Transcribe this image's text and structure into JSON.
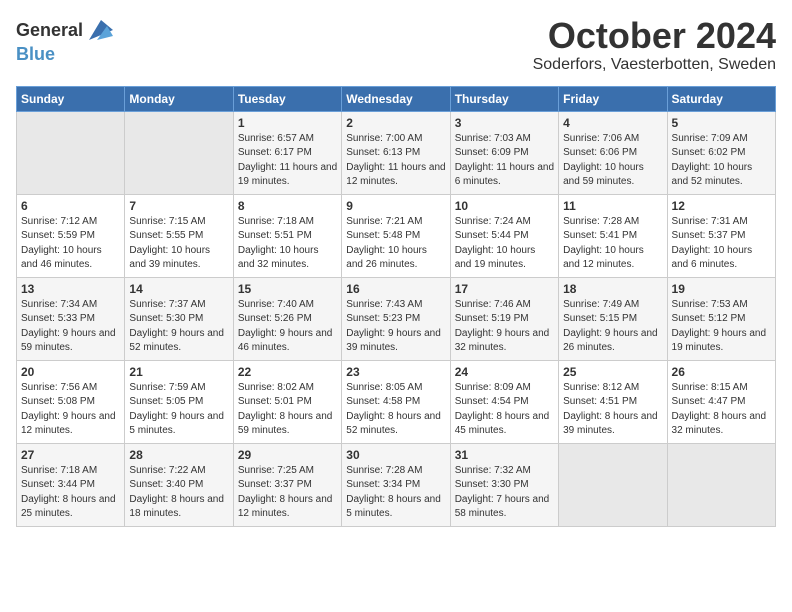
{
  "header": {
    "logo_general": "General",
    "logo_blue": "Blue",
    "month": "October 2024",
    "location": "Soderfors, Vaesterbotten, Sweden"
  },
  "weekdays": [
    "Sunday",
    "Monday",
    "Tuesday",
    "Wednesday",
    "Thursday",
    "Friday",
    "Saturday"
  ],
  "weeks": [
    [
      {
        "day": "",
        "empty": true
      },
      {
        "day": "",
        "empty": true
      },
      {
        "day": "1",
        "sunrise": "Sunrise: 6:57 AM",
        "sunset": "Sunset: 6:17 PM",
        "daylight": "Daylight: 11 hours and 19 minutes."
      },
      {
        "day": "2",
        "sunrise": "Sunrise: 7:00 AM",
        "sunset": "Sunset: 6:13 PM",
        "daylight": "Daylight: 11 hours and 12 minutes."
      },
      {
        "day": "3",
        "sunrise": "Sunrise: 7:03 AM",
        "sunset": "Sunset: 6:09 PM",
        "daylight": "Daylight: 11 hours and 6 minutes."
      },
      {
        "day": "4",
        "sunrise": "Sunrise: 7:06 AM",
        "sunset": "Sunset: 6:06 PM",
        "daylight": "Daylight: 10 hours and 59 minutes."
      },
      {
        "day": "5",
        "sunrise": "Sunrise: 7:09 AM",
        "sunset": "Sunset: 6:02 PM",
        "daylight": "Daylight: 10 hours and 52 minutes."
      }
    ],
    [
      {
        "day": "6",
        "sunrise": "Sunrise: 7:12 AM",
        "sunset": "Sunset: 5:59 PM",
        "daylight": "Daylight: 10 hours and 46 minutes."
      },
      {
        "day": "7",
        "sunrise": "Sunrise: 7:15 AM",
        "sunset": "Sunset: 5:55 PM",
        "daylight": "Daylight: 10 hours and 39 minutes."
      },
      {
        "day": "8",
        "sunrise": "Sunrise: 7:18 AM",
        "sunset": "Sunset: 5:51 PM",
        "daylight": "Daylight: 10 hours and 32 minutes."
      },
      {
        "day": "9",
        "sunrise": "Sunrise: 7:21 AM",
        "sunset": "Sunset: 5:48 PM",
        "daylight": "Daylight: 10 hours and 26 minutes."
      },
      {
        "day": "10",
        "sunrise": "Sunrise: 7:24 AM",
        "sunset": "Sunset: 5:44 PM",
        "daylight": "Daylight: 10 hours and 19 minutes."
      },
      {
        "day": "11",
        "sunrise": "Sunrise: 7:28 AM",
        "sunset": "Sunset: 5:41 PM",
        "daylight": "Daylight: 10 hours and 12 minutes."
      },
      {
        "day": "12",
        "sunrise": "Sunrise: 7:31 AM",
        "sunset": "Sunset: 5:37 PM",
        "daylight": "Daylight: 10 hours and 6 minutes."
      }
    ],
    [
      {
        "day": "13",
        "sunrise": "Sunrise: 7:34 AM",
        "sunset": "Sunset: 5:33 PM",
        "daylight": "Daylight: 9 hours and 59 minutes."
      },
      {
        "day": "14",
        "sunrise": "Sunrise: 7:37 AM",
        "sunset": "Sunset: 5:30 PM",
        "daylight": "Daylight: 9 hours and 52 minutes."
      },
      {
        "day": "15",
        "sunrise": "Sunrise: 7:40 AM",
        "sunset": "Sunset: 5:26 PM",
        "daylight": "Daylight: 9 hours and 46 minutes."
      },
      {
        "day": "16",
        "sunrise": "Sunrise: 7:43 AM",
        "sunset": "Sunset: 5:23 PM",
        "daylight": "Daylight: 9 hours and 39 minutes."
      },
      {
        "day": "17",
        "sunrise": "Sunrise: 7:46 AM",
        "sunset": "Sunset: 5:19 PM",
        "daylight": "Daylight: 9 hours and 32 minutes."
      },
      {
        "day": "18",
        "sunrise": "Sunrise: 7:49 AM",
        "sunset": "Sunset: 5:15 PM",
        "daylight": "Daylight: 9 hours and 26 minutes."
      },
      {
        "day": "19",
        "sunrise": "Sunrise: 7:53 AM",
        "sunset": "Sunset: 5:12 PM",
        "daylight": "Daylight: 9 hours and 19 minutes."
      }
    ],
    [
      {
        "day": "20",
        "sunrise": "Sunrise: 7:56 AM",
        "sunset": "Sunset: 5:08 PM",
        "daylight": "Daylight: 9 hours and 12 minutes."
      },
      {
        "day": "21",
        "sunrise": "Sunrise: 7:59 AM",
        "sunset": "Sunset: 5:05 PM",
        "daylight": "Daylight: 9 hours and 5 minutes."
      },
      {
        "day": "22",
        "sunrise": "Sunrise: 8:02 AM",
        "sunset": "Sunset: 5:01 PM",
        "daylight": "Daylight: 8 hours and 59 minutes."
      },
      {
        "day": "23",
        "sunrise": "Sunrise: 8:05 AM",
        "sunset": "Sunset: 4:58 PM",
        "daylight": "Daylight: 8 hours and 52 minutes."
      },
      {
        "day": "24",
        "sunrise": "Sunrise: 8:09 AM",
        "sunset": "Sunset: 4:54 PM",
        "daylight": "Daylight: 8 hours and 45 minutes."
      },
      {
        "day": "25",
        "sunrise": "Sunrise: 8:12 AM",
        "sunset": "Sunset: 4:51 PM",
        "daylight": "Daylight: 8 hours and 39 minutes."
      },
      {
        "day": "26",
        "sunrise": "Sunrise: 8:15 AM",
        "sunset": "Sunset: 4:47 PM",
        "daylight": "Daylight: 8 hours and 32 minutes."
      }
    ],
    [
      {
        "day": "27",
        "sunrise": "Sunrise: 7:18 AM",
        "sunset": "Sunset: 3:44 PM",
        "daylight": "Daylight: 8 hours and 25 minutes."
      },
      {
        "day": "28",
        "sunrise": "Sunrise: 7:22 AM",
        "sunset": "Sunset: 3:40 PM",
        "daylight": "Daylight: 8 hours and 18 minutes."
      },
      {
        "day": "29",
        "sunrise": "Sunrise: 7:25 AM",
        "sunset": "Sunset: 3:37 PM",
        "daylight": "Daylight: 8 hours and 12 minutes."
      },
      {
        "day": "30",
        "sunrise": "Sunrise: 7:28 AM",
        "sunset": "Sunset: 3:34 PM",
        "daylight": "Daylight: 8 hours and 5 minutes."
      },
      {
        "day": "31",
        "sunrise": "Sunrise: 7:32 AM",
        "sunset": "Sunset: 3:30 PM",
        "daylight": "Daylight: 7 hours and 58 minutes."
      },
      {
        "day": "",
        "empty": true
      },
      {
        "day": "",
        "empty": true
      }
    ]
  ]
}
